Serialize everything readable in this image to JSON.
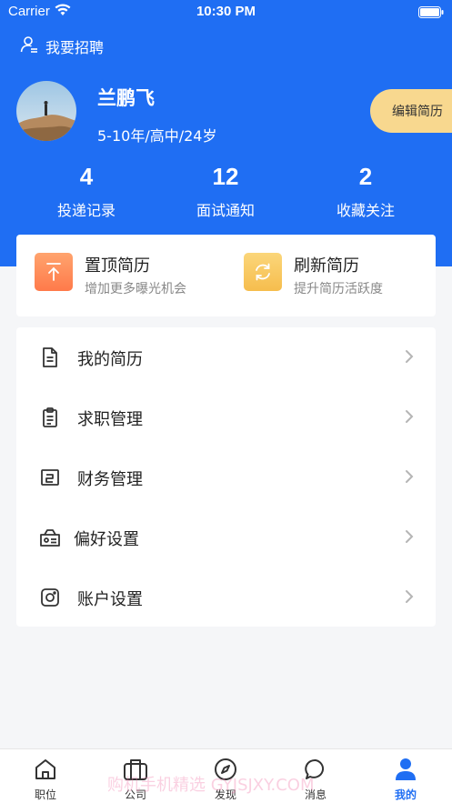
{
  "status_bar": {
    "carrier": "Carrier",
    "time": "10:30 PM"
  },
  "header": {
    "recruit_label": "我要招聘",
    "user_name": "兰鹏飞",
    "user_meta": "5-10年/高中/24岁",
    "edit_resume_label": "编辑简历"
  },
  "stats": [
    {
      "value": "4",
      "label": "投递记录"
    },
    {
      "value": "12",
      "label": "面试通知"
    },
    {
      "value": "2",
      "label": "收藏关注"
    }
  ],
  "features": [
    {
      "title": "置顶简历",
      "subtitle": "增加更多曝光机会",
      "icon": "pin-top-icon",
      "color": "#ff8a5b"
    },
    {
      "title": "刷新简历",
      "subtitle": "提升简历活跃度",
      "icon": "refresh-icon",
      "color": "#f9c95e"
    }
  ],
  "menu": [
    {
      "label": "我的简历",
      "icon": "document-icon"
    },
    {
      "label": "求职管理",
      "icon": "clipboard-icon"
    },
    {
      "label": "财务管理",
      "icon": "finance-icon"
    },
    {
      "label": "偏好设置",
      "icon": "preference-icon"
    },
    {
      "label": "账户设置",
      "icon": "account-icon"
    }
  ],
  "tabbar": [
    {
      "label": "职位",
      "icon": "home-icon"
    },
    {
      "label": "公司",
      "icon": "briefcase-icon"
    },
    {
      "label": "发现",
      "icon": "compass-icon"
    },
    {
      "label": "消息",
      "icon": "chat-icon"
    },
    {
      "label": "我的",
      "icon": "person-icon",
      "active": true
    }
  ],
  "watermark": "购机手机精选 GYJSJXY.COM",
  "colors": {
    "primary": "#1f6ef3",
    "edit_button": "#f8d88f"
  }
}
